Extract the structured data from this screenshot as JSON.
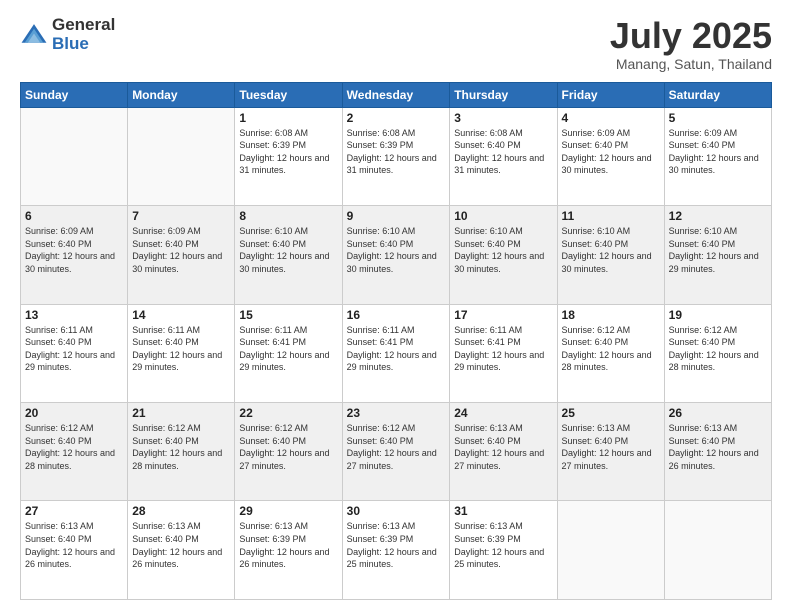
{
  "logo": {
    "general": "General",
    "blue": "Blue"
  },
  "header": {
    "month": "July 2025",
    "location": "Manang, Satun, Thailand"
  },
  "weekdays": [
    "Sunday",
    "Monday",
    "Tuesday",
    "Wednesday",
    "Thursday",
    "Friday",
    "Saturday"
  ],
  "weeks": [
    [
      {
        "day": "",
        "info": ""
      },
      {
        "day": "",
        "info": ""
      },
      {
        "day": "1",
        "info": "Sunrise: 6:08 AM\nSunset: 6:39 PM\nDaylight: 12 hours and 31 minutes."
      },
      {
        "day": "2",
        "info": "Sunrise: 6:08 AM\nSunset: 6:39 PM\nDaylight: 12 hours and 31 minutes."
      },
      {
        "day": "3",
        "info": "Sunrise: 6:08 AM\nSunset: 6:40 PM\nDaylight: 12 hours and 31 minutes."
      },
      {
        "day": "4",
        "info": "Sunrise: 6:09 AM\nSunset: 6:40 PM\nDaylight: 12 hours and 30 minutes."
      },
      {
        "day": "5",
        "info": "Sunrise: 6:09 AM\nSunset: 6:40 PM\nDaylight: 12 hours and 30 minutes."
      }
    ],
    [
      {
        "day": "6",
        "info": "Sunrise: 6:09 AM\nSunset: 6:40 PM\nDaylight: 12 hours and 30 minutes."
      },
      {
        "day": "7",
        "info": "Sunrise: 6:09 AM\nSunset: 6:40 PM\nDaylight: 12 hours and 30 minutes."
      },
      {
        "day": "8",
        "info": "Sunrise: 6:10 AM\nSunset: 6:40 PM\nDaylight: 12 hours and 30 minutes."
      },
      {
        "day": "9",
        "info": "Sunrise: 6:10 AM\nSunset: 6:40 PM\nDaylight: 12 hours and 30 minutes."
      },
      {
        "day": "10",
        "info": "Sunrise: 6:10 AM\nSunset: 6:40 PM\nDaylight: 12 hours and 30 minutes."
      },
      {
        "day": "11",
        "info": "Sunrise: 6:10 AM\nSunset: 6:40 PM\nDaylight: 12 hours and 30 minutes."
      },
      {
        "day": "12",
        "info": "Sunrise: 6:10 AM\nSunset: 6:40 PM\nDaylight: 12 hours and 29 minutes."
      }
    ],
    [
      {
        "day": "13",
        "info": "Sunrise: 6:11 AM\nSunset: 6:40 PM\nDaylight: 12 hours and 29 minutes."
      },
      {
        "day": "14",
        "info": "Sunrise: 6:11 AM\nSunset: 6:40 PM\nDaylight: 12 hours and 29 minutes."
      },
      {
        "day": "15",
        "info": "Sunrise: 6:11 AM\nSunset: 6:41 PM\nDaylight: 12 hours and 29 minutes."
      },
      {
        "day": "16",
        "info": "Sunrise: 6:11 AM\nSunset: 6:41 PM\nDaylight: 12 hours and 29 minutes."
      },
      {
        "day": "17",
        "info": "Sunrise: 6:11 AM\nSunset: 6:41 PM\nDaylight: 12 hours and 29 minutes."
      },
      {
        "day": "18",
        "info": "Sunrise: 6:12 AM\nSunset: 6:40 PM\nDaylight: 12 hours and 28 minutes."
      },
      {
        "day": "19",
        "info": "Sunrise: 6:12 AM\nSunset: 6:40 PM\nDaylight: 12 hours and 28 minutes."
      }
    ],
    [
      {
        "day": "20",
        "info": "Sunrise: 6:12 AM\nSunset: 6:40 PM\nDaylight: 12 hours and 28 minutes."
      },
      {
        "day": "21",
        "info": "Sunrise: 6:12 AM\nSunset: 6:40 PM\nDaylight: 12 hours and 28 minutes."
      },
      {
        "day": "22",
        "info": "Sunrise: 6:12 AM\nSunset: 6:40 PM\nDaylight: 12 hours and 27 minutes."
      },
      {
        "day": "23",
        "info": "Sunrise: 6:12 AM\nSunset: 6:40 PM\nDaylight: 12 hours and 27 minutes."
      },
      {
        "day": "24",
        "info": "Sunrise: 6:13 AM\nSunset: 6:40 PM\nDaylight: 12 hours and 27 minutes."
      },
      {
        "day": "25",
        "info": "Sunrise: 6:13 AM\nSunset: 6:40 PM\nDaylight: 12 hours and 27 minutes."
      },
      {
        "day": "26",
        "info": "Sunrise: 6:13 AM\nSunset: 6:40 PM\nDaylight: 12 hours and 26 minutes."
      }
    ],
    [
      {
        "day": "27",
        "info": "Sunrise: 6:13 AM\nSunset: 6:40 PM\nDaylight: 12 hours and 26 minutes."
      },
      {
        "day": "28",
        "info": "Sunrise: 6:13 AM\nSunset: 6:40 PM\nDaylight: 12 hours and 26 minutes."
      },
      {
        "day": "29",
        "info": "Sunrise: 6:13 AM\nSunset: 6:39 PM\nDaylight: 12 hours and 26 minutes."
      },
      {
        "day": "30",
        "info": "Sunrise: 6:13 AM\nSunset: 6:39 PM\nDaylight: 12 hours and 25 minutes."
      },
      {
        "day": "31",
        "info": "Sunrise: 6:13 AM\nSunset: 6:39 PM\nDaylight: 12 hours and 25 minutes."
      },
      {
        "day": "",
        "info": ""
      },
      {
        "day": "",
        "info": ""
      }
    ]
  ]
}
